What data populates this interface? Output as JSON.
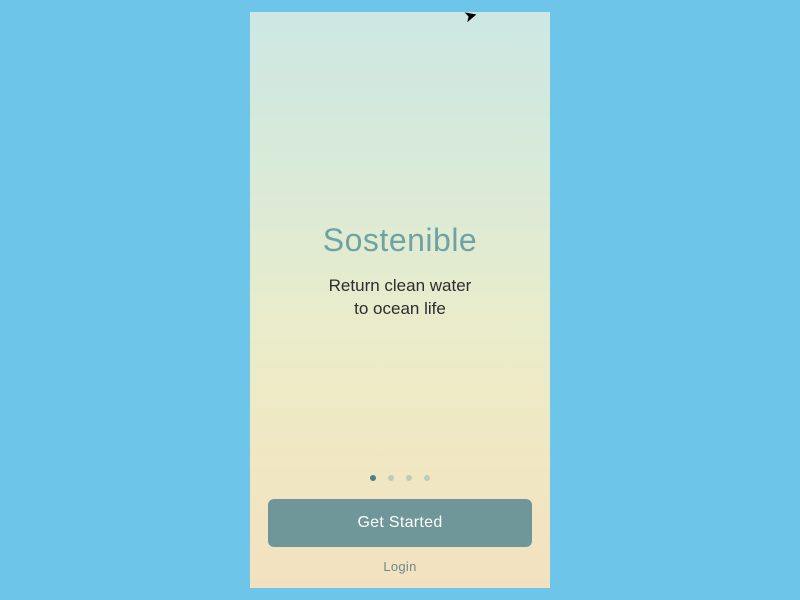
{
  "hero": {
    "brand": "Sostenible",
    "tagline_line1": "Return clean water",
    "tagline_line2": "to ocean life"
  },
  "pagination": {
    "count": 4,
    "active_index": 0
  },
  "cta": {
    "primary": "Get Started",
    "secondary": "Login"
  },
  "colors": {
    "page_bg": "#6ec5ea",
    "brand_text": "#6fa3a3",
    "button_bg": "#6f979a"
  }
}
